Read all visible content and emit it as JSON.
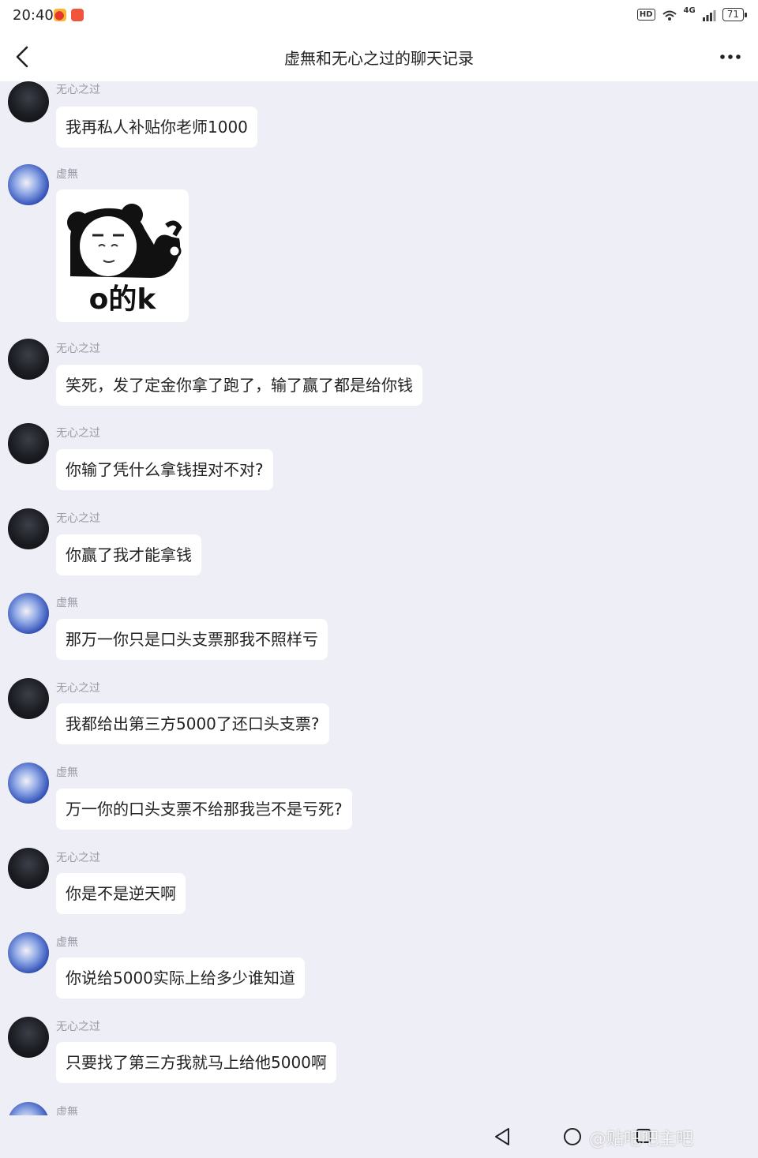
{
  "status_bar": {
    "time": "20:40",
    "hd": "HD",
    "network": "4G",
    "battery": "71"
  },
  "header": {
    "title": "虚無和无心之过的聊天记录"
  },
  "messages": [
    {
      "sender": "无心之过",
      "text": "我再私人补贴你老师1000"
    },
    {
      "sender": "虚無",
      "sticker_text": "o的k"
    },
    {
      "sender": "无心之过",
      "text": "笑死，发了定金你拿了跑了，输了赢了都是给你钱"
    },
    {
      "sender": "无心之过",
      "text": "你输了凭什么拿钱捏对不对?"
    },
    {
      "sender": "无心之过",
      "text": "你赢了我才能拿钱"
    },
    {
      "sender": "虚無",
      "text": "那万一你只是口头支票那我不照样亏"
    },
    {
      "sender": "无心之过",
      "text": "我都给出第三方5000了还口头支票?"
    },
    {
      "sender": "虚無",
      "text": "万一你的口头支票不给那我岂不是亏死?"
    },
    {
      "sender": "无心之过",
      "text": "你是不是逆天啊"
    },
    {
      "sender": "虚無",
      "text": "你说给5000实际上给多少谁知道"
    },
    {
      "sender": "无心之过",
      "text": "只要找了第三方我就马上给他5000啊"
    },
    {
      "sender": "虚無"
    }
  ],
  "watermark": "@贴吧吧主吧",
  "icons": {
    "back": "back-arrow-icon",
    "more": "more-dots-icon",
    "nav_back": "nav-back-triangle-icon",
    "nav_home": "nav-home-circle-icon",
    "nav_recent": "nav-recent-square-icon"
  }
}
